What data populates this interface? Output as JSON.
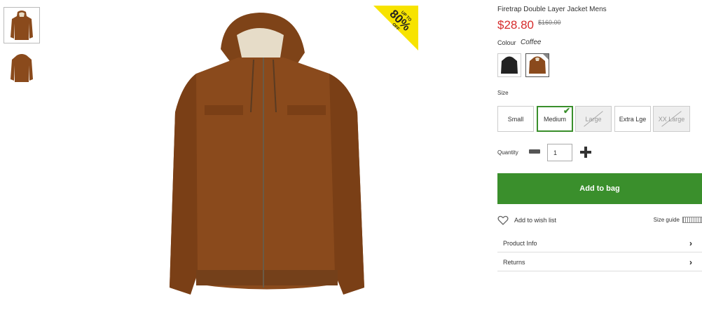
{
  "thumbnails": [
    {
      "name": "jacket-hood-up"
    },
    {
      "name": "jacket-hood-down"
    }
  ],
  "badge": {
    "text": "80%",
    "small_top": "UP TO",
    "small_bottom": "OFF",
    "color": "#f7e300"
  },
  "product": {
    "title": "Firetrap Double Layer Jacket Mens",
    "price": "$28.80",
    "old_price": "$160.00",
    "colour_label": "Colour",
    "colour_value": "Coffee",
    "size_label": "Size",
    "sizes": [
      {
        "label": "Small",
        "state": "available"
      },
      {
        "label": "Medium",
        "state": "selected"
      },
      {
        "label": "Large",
        "state": "unavailable"
      },
      {
        "label": "Extra Lge",
        "state": "available"
      },
      {
        "label": "XX Large",
        "state": "unavailable"
      }
    ],
    "quantity_label": "Quantity",
    "quantity_value": "1",
    "add_to_bag": "Add to bag",
    "wish_list": "Add to wish list",
    "size_guide": "Size guide",
    "accordions": [
      "Product Info",
      "Returns"
    ]
  },
  "colors": {
    "accent": "#3a8f2c",
    "price": "#d62b2b",
    "jacket": "#8a4a1c"
  }
}
